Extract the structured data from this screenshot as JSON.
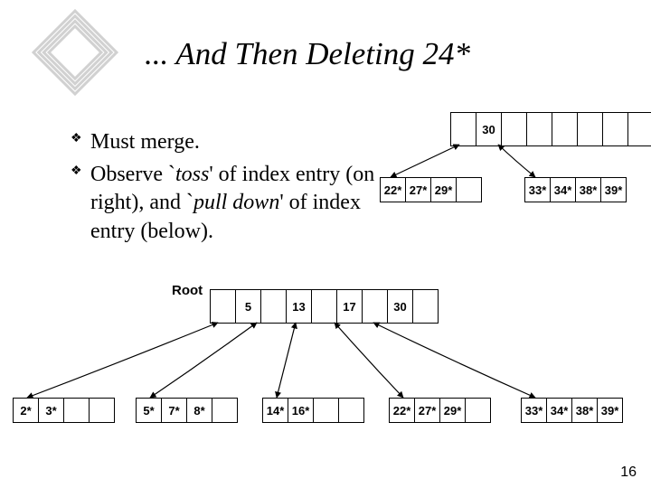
{
  "title": "... And Then Deleting 24*",
  "bullets": [
    {
      "plain1": "Must merge."
    },
    {
      "plain1": "Observe `",
      "em1": "toss",
      "plain2": "' of index entry (on right), and `",
      "em2": "pull down",
      "plain3": "' of index entry (below)."
    }
  ],
  "topParent": {
    "keys": [
      "30"
    ]
  },
  "topLeaves": {
    "left": [
      "22*",
      "27*",
      "29*"
    ],
    "right": [
      "33*",
      "34*",
      "38*",
      "39*"
    ]
  },
  "rootLabel": "Root",
  "root": {
    "keys": [
      "5",
      "13",
      "17",
      "30"
    ]
  },
  "leaves": [
    [
      "2*",
      "3*"
    ],
    [
      "5*",
      "7*",
      "8*"
    ],
    [
      "14*",
      "16*"
    ],
    [
      "22*",
      "27*",
      "29*"
    ],
    [
      "33*",
      "34*",
      "38*",
      "39*"
    ]
  ],
  "slideNumber": "16"
}
